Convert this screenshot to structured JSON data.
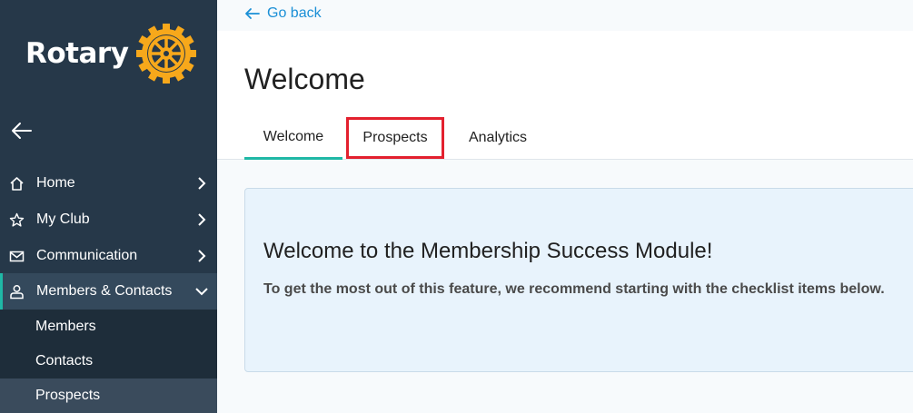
{
  "brand": {
    "name": "Rotary",
    "wheel_color": "#f7a81b"
  },
  "sidebar": {
    "collapse_icon": "arrow-left-icon",
    "items": [
      {
        "label": "Home",
        "icon": "home-icon",
        "chevron": "chevron-right-icon"
      },
      {
        "label": "My Club",
        "icon": "star-icon",
        "chevron": "chevron-right-icon"
      },
      {
        "label": "Communication",
        "icon": "mail-icon",
        "chevron": "chevron-right-icon"
      },
      {
        "label": "Members & Contacts",
        "icon": "user-icon",
        "chevron": "chevron-down-icon"
      }
    ],
    "sub_items": [
      {
        "label": "Members"
      },
      {
        "label": "Contacts"
      },
      {
        "label": "Prospects"
      }
    ]
  },
  "topbar": {
    "go_back": "Go back"
  },
  "header": {
    "title": "Welcome",
    "tabs": [
      {
        "label": "Welcome",
        "active": true
      },
      {
        "label": "Prospects",
        "highlighted": true
      },
      {
        "label": "Analytics"
      }
    ]
  },
  "card": {
    "title": "Welcome to the Membership Success Module!",
    "text": "To get the most out of this feature, we recommend starting with the checklist items below."
  },
  "colors": {
    "sidebar": "#263849",
    "accent": "#1fb8a6",
    "link": "#1a8fd6",
    "highlight": "#e3202e"
  }
}
